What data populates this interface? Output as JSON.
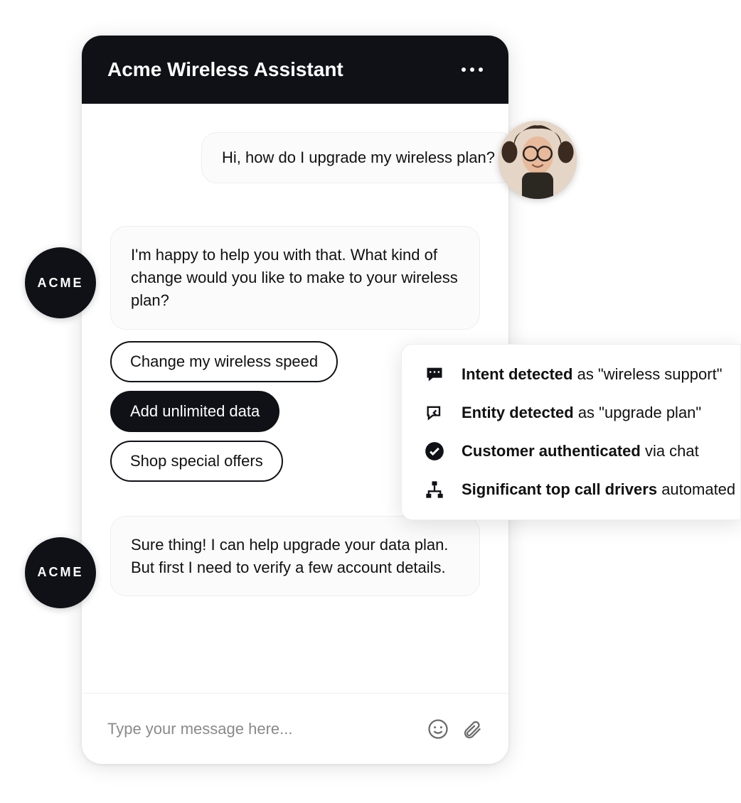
{
  "header": {
    "title": "Acme Wireless Assistant"
  },
  "bot": {
    "avatar_label": "ACME"
  },
  "messages": {
    "user_1": "Hi, how do I upgrade my wireless plan?",
    "bot_1": "I'm happy to help you with that. What kind of change would you like to make to your wireless plan?",
    "bot_2": "Sure thing! I can help upgrade your data plan. But first I need to verify a few account details."
  },
  "chips": {
    "option_1": "Change my wireless speed",
    "option_2": "Add unlimited data",
    "option_3": "Shop special offers"
  },
  "input": {
    "placeholder": "Type your message here..."
  },
  "insights": {
    "row1_bold": "Intent detected",
    "row1_rest": " as \"wireless support\"",
    "row2_bold": "Entity detected",
    "row2_rest": " as \"upgrade plan\"",
    "row3_bold": "Customer authenticated",
    "row3_rest": " via chat",
    "row4_bold": "Significant top call drivers",
    "row4_rest": " automated"
  }
}
